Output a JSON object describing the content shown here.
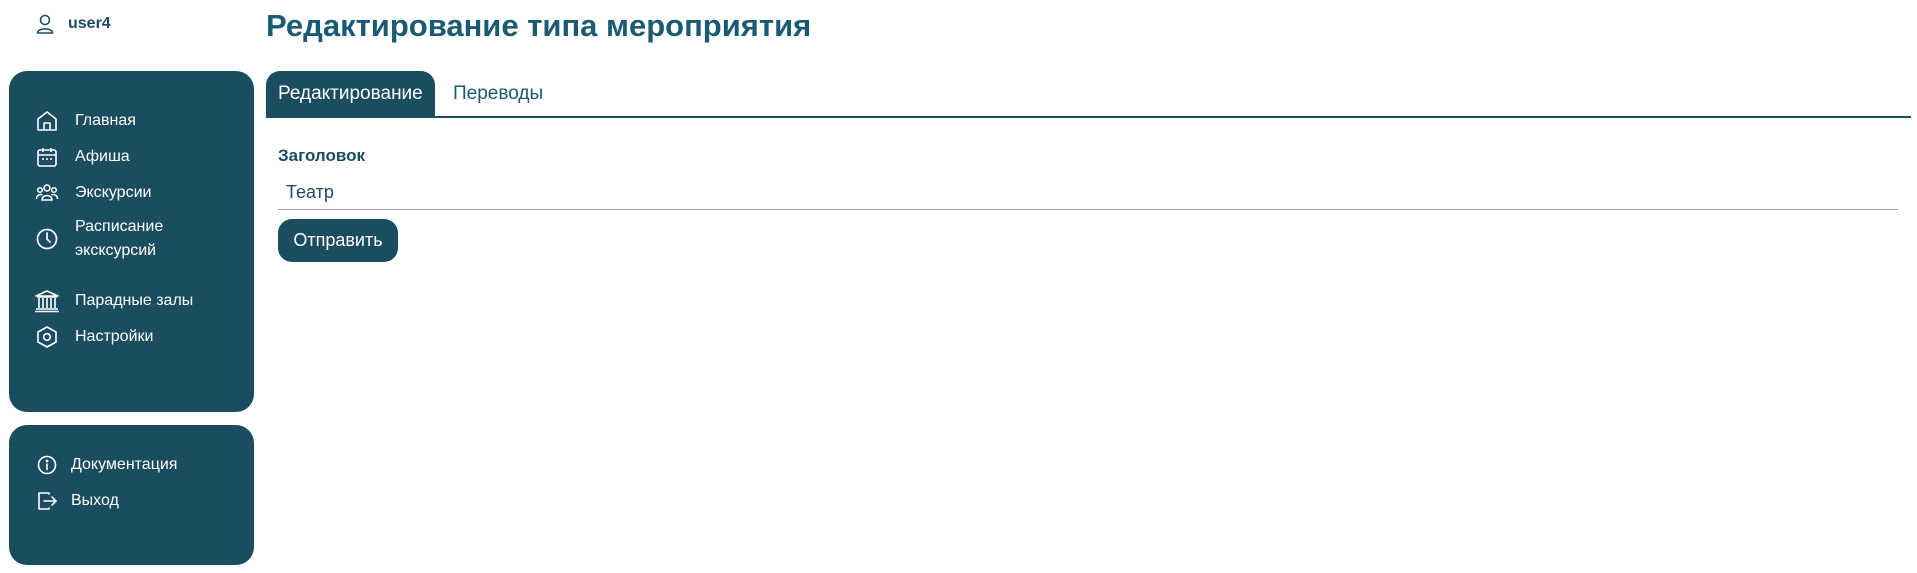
{
  "user": {
    "name": "user4",
    "icon": "user-icon"
  },
  "sidebar": {
    "items": [
      {
        "label": "Главная",
        "icon": "home-icon"
      },
      {
        "label": "Афиша",
        "icon": "calendar-icon"
      },
      {
        "label": "Экскурсии",
        "icon": "group-icon"
      },
      {
        "label": "Расписание\nэксксурсий",
        "icon": "clock-icon"
      },
      {
        "label": "Парадные залы",
        "icon": "museum-icon"
      },
      {
        "label": "Настройки",
        "icon": "settings-hex-icon"
      }
    ],
    "bottom_items": [
      {
        "label": "Документация",
        "icon": "info-icon"
      },
      {
        "label": "Выход",
        "icon": "logout-icon"
      }
    ]
  },
  "page": {
    "title": "Редактирование типа мероприятия"
  },
  "tabs": [
    {
      "label": "Редактирование",
      "active": true
    },
    {
      "label": "Переводы",
      "active": false
    }
  ],
  "form": {
    "title_label": "Заголовок",
    "title_value": "Театр",
    "submit_label": "Отправить"
  },
  "colors": {
    "primary": "#1a4d5f",
    "title": "#1a5b73",
    "background": "#ffffff"
  }
}
